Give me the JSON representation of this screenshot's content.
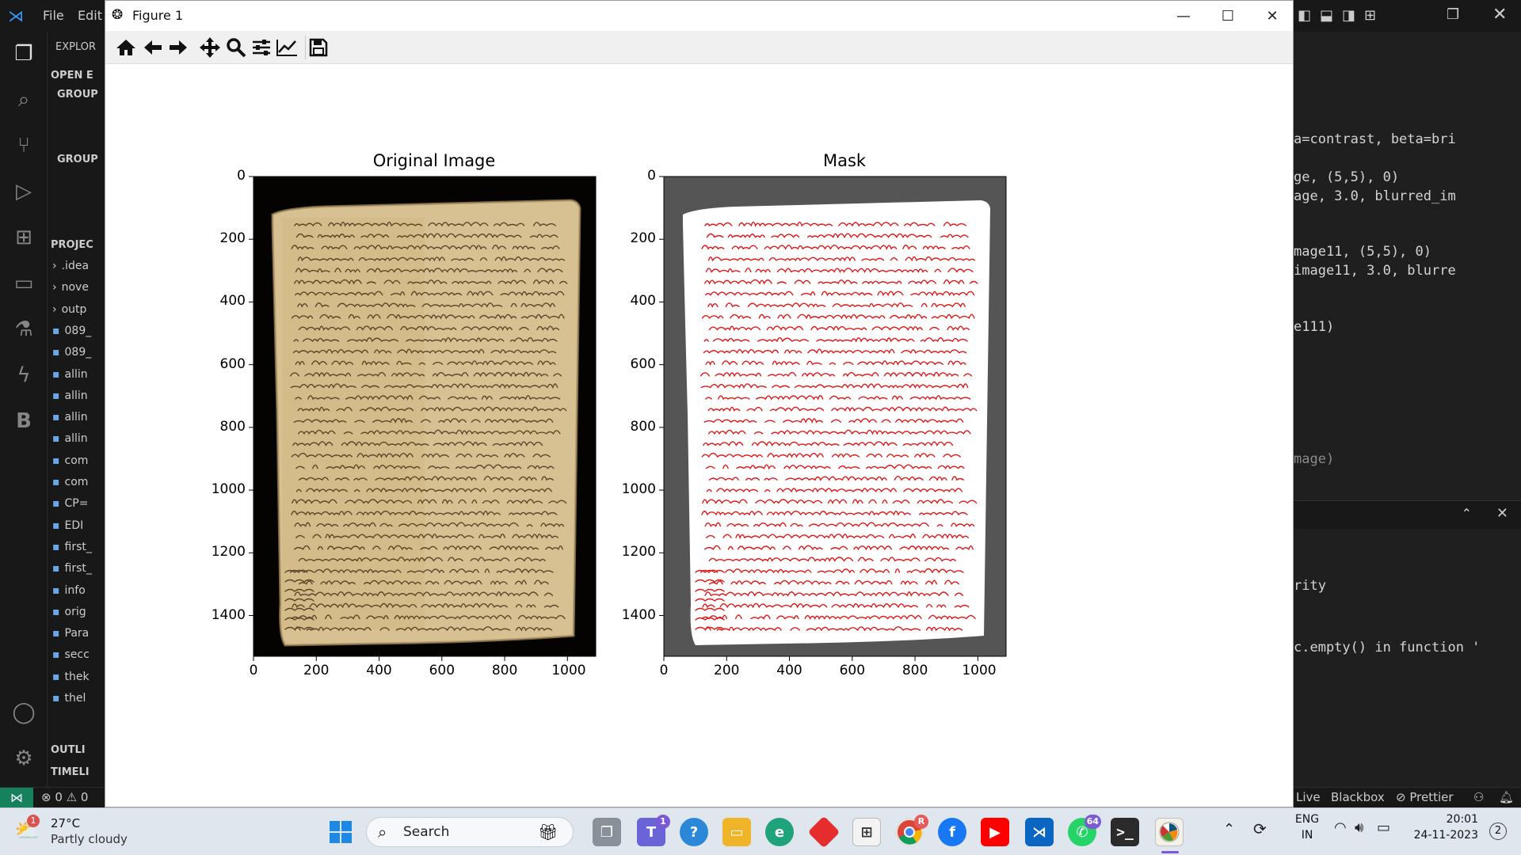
{
  "vscode": {
    "menu": [
      "File",
      "Edit"
    ],
    "sidebar": {
      "explorer_label": "EXPLOR",
      "open_editors": "OPEN E",
      "group1": "GROUP",
      "group2": "GROUP",
      "project": "PROJEC",
      "files": [
        ".idea",
        "nove",
        "outp",
        "089_",
        "089_",
        "allin",
        "allin",
        "allin",
        "allin",
        "com",
        "com",
        "CP=",
        "EDI",
        "first_",
        "first_",
        "info",
        "orig",
        "Para",
        "secc",
        "thek",
        "thel"
      ],
      "outline": "OUTLI",
      "timeline": "TIMELI"
    },
    "code_lines": [
      "a=contrast, beta=bri",
      "ge, (5,5), 0)",
      "age, 3.0, blurred_im",
      "mage11, (5,5), 0)",
      "image11, 3.0, blurre",
      "e111)",
      "mage)",
      "rity",
      "c.empty() in function '"
    ],
    "status": {
      "errors": "0",
      "warnings": "0",
      "live": "Live",
      "blackbox": "Blackbox",
      "prettier": "Prettier"
    }
  },
  "figure": {
    "window_title": "Figure 1",
    "toolbar_icons": [
      "home-icon",
      "back-icon",
      "forward-icon",
      "pan-icon",
      "zoom-icon",
      "configure-subplots-icon",
      "edit-axis-icon",
      "save-icon"
    ],
    "panels": [
      {
        "title": "Original Image",
        "xticks": [
          "0",
          "200",
          "400",
          "600",
          "800",
          "1000"
        ],
        "yticks": [
          "0",
          "200",
          "400",
          "600",
          "800",
          "1000",
          "1200",
          "1400"
        ]
      },
      {
        "title": "Mask",
        "xticks": [
          "0",
          "200",
          "400",
          "600",
          "800",
          "1000"
        ],
        "yticks": [
          "0",
          "200",
          "400",
          "600",
          "800",
          "1000",
          "1200",
          "1400"
        ]
      }
    ],
    "colors": {
      "paper": "#d9c497",
      "ink": "#4a3118",
      "mask_bg": "#555555",
      "mask_ink": "#e01818"
    }
  },
  "taskbar": {
    "weather_temp": "27°C",
    "weather_desc": "Partly cloudy",
    "weather_badge": "1",
    "search_label": "Search",
    "teams_badge": "1",
    "whatsapp_badge": "64",
    "chrome_badge": "R",
    "language": "ENG",
    "region": "IN",
    "time": "20:01",
    "date": "24-11-2023",
    "notification_count": "2"
  }
}
